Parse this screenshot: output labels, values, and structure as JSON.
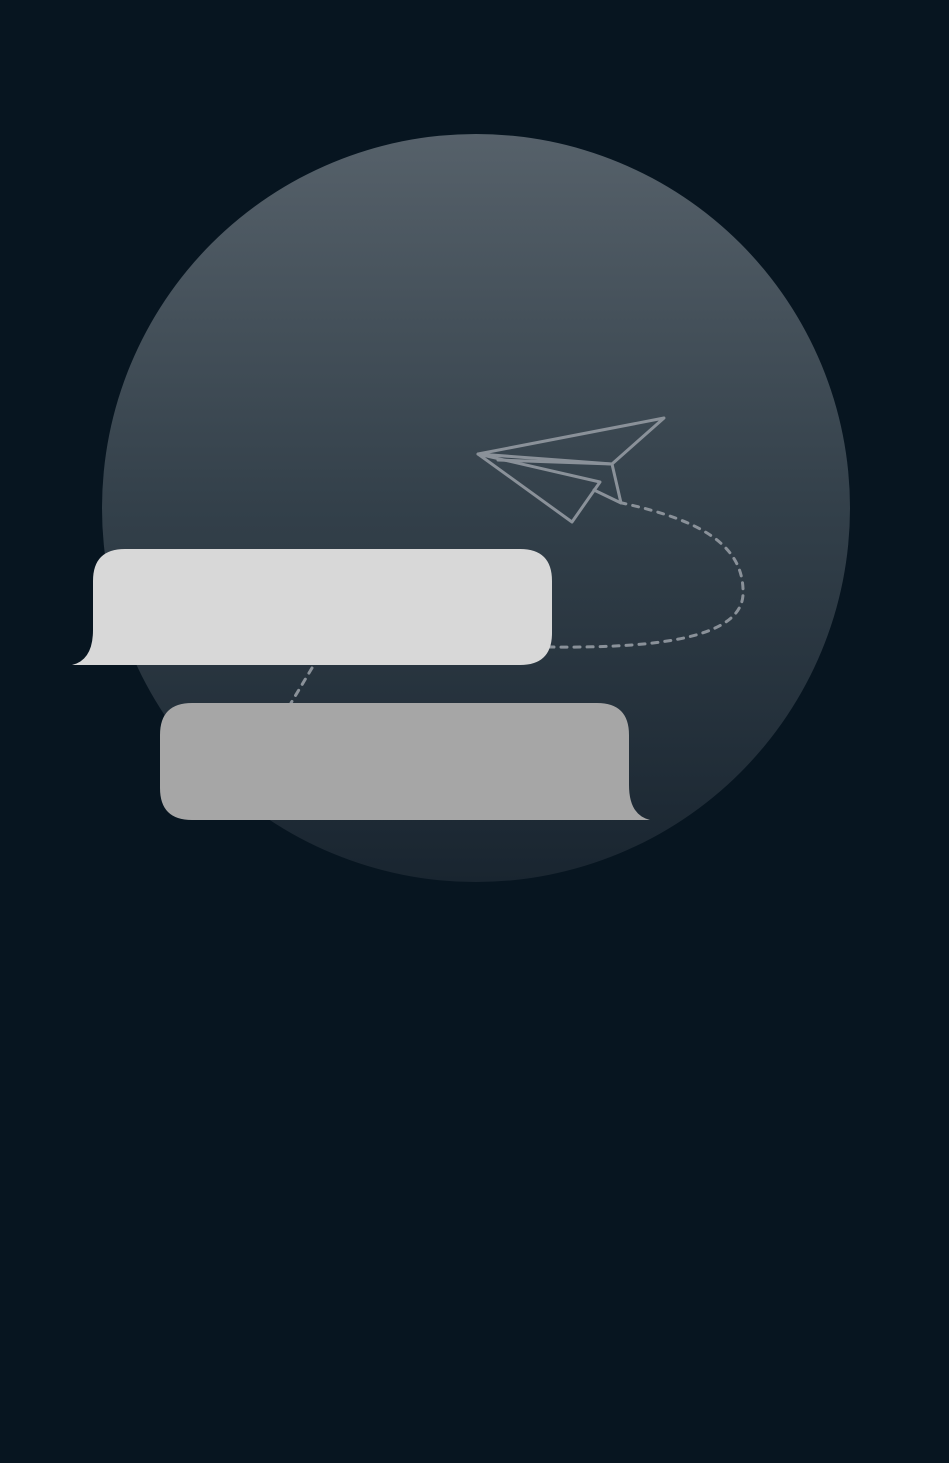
{
  "screen": {
    "background_color": "#071520"
  },
  "illustration": {
    "circle_gradient_top": "#56616A",
    "circle_gradient_bottom": "#192530",
    "bubble_incoming_color": "#D8D8D8",
    "bubble_outgoing_color": "#A6A6A6",
    "paper_plane_color": "#8A9199",
    "dashed_trail_color": "#8A9199",
    "icons": [
      "paper-plane-icon",
      "chat-bubble-incoming",
      "chat-bubble-outgoing",
      "dashed-flight-path"
    ]
  }
}
